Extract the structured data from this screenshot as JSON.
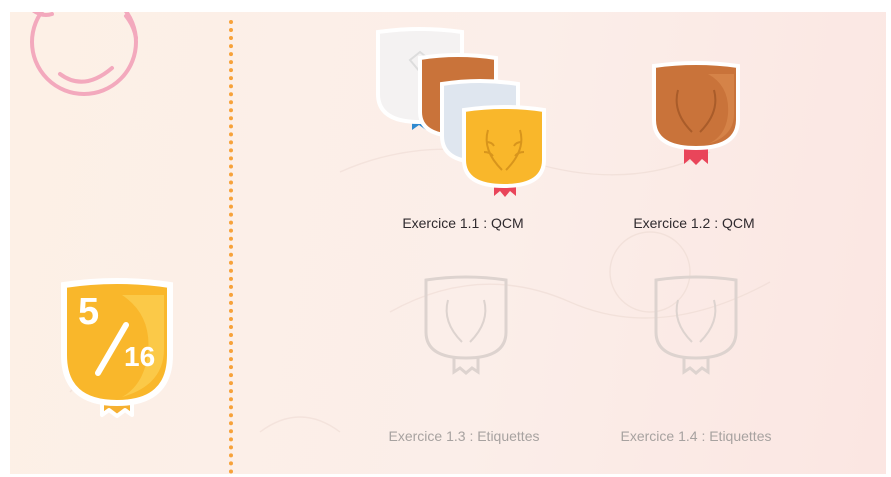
{
  "score": {
    "earned": "5",
    "total": "16"
  },
  "exercises": [
    {
      "label": "Exercice 1.1 : QCM",
      "medal": "gold-stack",
      "unlocked": true
    },
    {
      "label": "Exercice 1.2 : QCM",
      "medal": "bronze",
      "unlocked": true
    },
    {
      "label": "Exercice 1.3 : Etiquettes",
      "medal": "locked",
      "unlocked": false
    },
    {
      "label": "Exercice 1.4 : Etiquettes",
      "medal": "locked",
      "unlocked": false
    }
  ],
  "colors": {
    "gold": "#f9b72b",
    "bronze": "#c9733a",
    "silver": "#dfe6ef",
    "white": "#f4f2f2",
    "ribbon_red": "#e9455a",
    "ribbon_blue": "#2f8ad0",
    "divider": "#f7a23a",
    "deco_ring": "#f3a9bd",
    "locked": "#d9d2cf"
  },
  "icons": [
    "laurel-wreath-icon",
    "diamond-icon",
    "ribbon-icon"
  ]
}
